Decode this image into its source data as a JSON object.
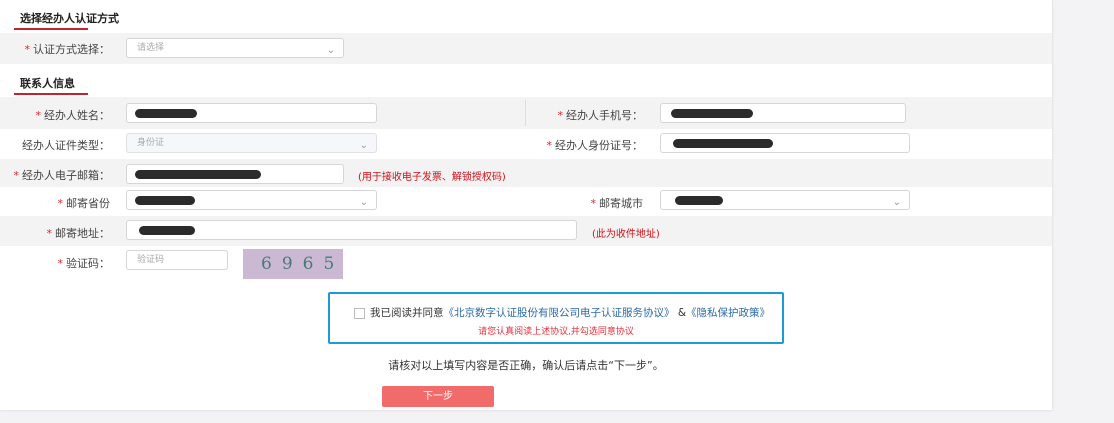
{
  "section1": {
    "title": "选择经办人认证方式",
    "auth_label": "认证方式选择：",
    "auth_placeholder": "请选择"
  },
  "section2": {
    "title": "联系人信息",
    "name_label": "经办人姓名：",
    "phone_label": "经办人手机号：",
    "idtype_label": "经办人证件类型：",
    "idtype_value": "身份证",
    "idno_label": "经办人身份证号：",
    "email_label": "经办人电子邮箱：",
    "email_hint": "(用于接收电子发票、解锁授权码)",
    "province_label": "邮寄省份",
    "city_label": "邮寄城市",
    "address_label": "邮寄地址：",
    "address_hint": "(此为收件地址)",
    "captcha_label": "验证码：",
    "captcha_placeholder": "验证码",
    "captcha_image_text": "6965"
  },
  "agreement": {
    "prefix": "我已阅读并同意",
    "link1": "《北京数字认证股份有限公司电子认证服务协议》",
    "amp": "&",
    "link2": "《隐私保护政策》",
    "warning": "请您认真阅读上述协议,并勾选同意协议"
  },
  "confirm_text": "请核对以上填写内容是否正确，确认后请点击“下一步”。",
  "next_button": "下一步",
  "colors": {
    "accent_red": "#c8202f",
    "required_star": "#e0202c",
    "agreement_border": "#1e9bd7",
    "button": "#f26b6b"
  }
}
